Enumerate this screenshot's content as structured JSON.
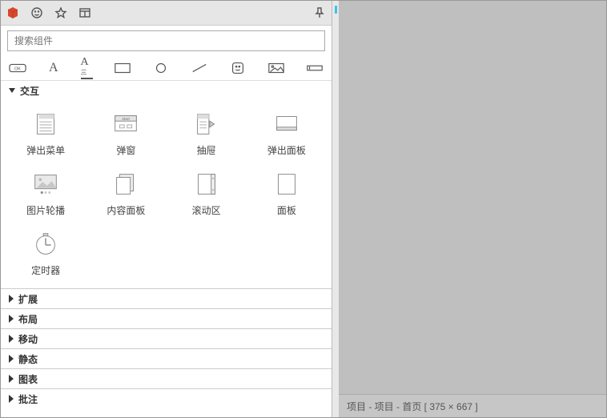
{
  "search": {
    "placeholder": "搜索组件"
  },
  "section_open": {
    "title": "交互",
    "items": [
      {
        "key": "popout_menu",
        "label": "弹出菜单"
      },
      {
        "key": "popup",
        "label": "弹窗"
      },
      {
        "key": "drawer",
        "label": "抽屉"
      },
      {
        "key": "popout_panel",
        "label": "弹出面板"
      },
      {
        "key": "image_carousel",
        "label": "图片轮播"
      },
      {
        "key": "content_panel",
        "label": "内容面板"
      },
      {
        "key": "scroll_area",
        "label": "滚动区"
      },
      {
        "key": "panel",
        "label": "面板"
      },
      {
        "key": "timer",
        "label": "定时器"
      }
    ]
  },
  "sections_collapsed": [
    {
      "key": "extend",
      "label": "扩展"
    },
    {
      "key": "layout",
      "label": "布局"
    },
    {
      "key": "mobile",
      "label": "移动"
    },
    {
      "key": "static",
      "label": "静态"
    },
    {
      "key": "chart",
      "label": "图表"
    },
    {
      "key": "annotate",
      "label": "批注"
    }
  ],
  "footer": {
    "text": "项目 - 项目 - 首页 [ 375 × 667 ]"
  },
  "popup_glyph_text": "Alert"
}
